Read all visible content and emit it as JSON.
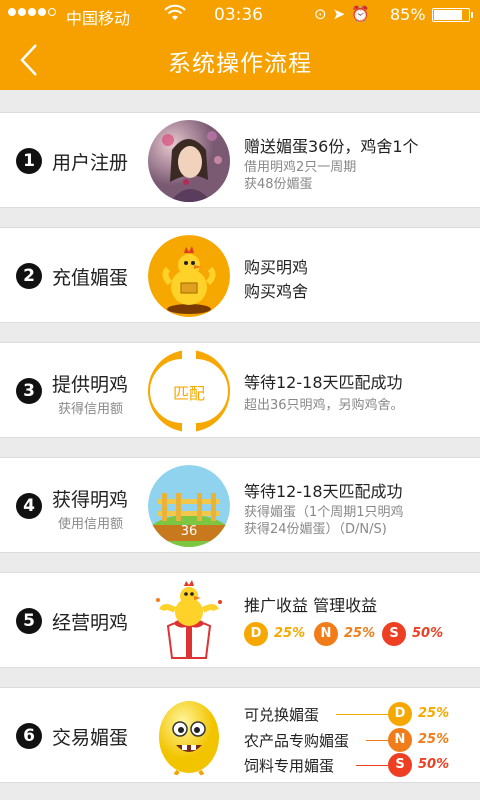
{
  "status_bar": {
    "carrier": "中国移动",
    "time": "03:36",
    "battery_text": "85%",
    "battery_level": 0.85
  },
  "header": {
    "title": "系统操作流程"
  },
  "steps": [
    {
      "number": "1",
      "label": "用户注册",
      "title": "赠送媚蛋36份，鸡舍1个",
      "sub1": "借用明鸡2只一周期",
      "sub2": "获48份媚蛋"
    },
    {
      "number": "2",
      "label": "充值媚蛋",
      "title": "购买明鸡",
      "title2": "购买鸡舍"
    },
    {
      "number": "3",
      "label": "提供明鸡",
      "sublabel": "获得信用额",
      "image_text": "匹配",
      "title": "等待12-18天匹配成功",
      "sub1": "超出36只明鸡，另购鸡舍。"
    },
    {
      "number": "4",
      "label": "获得明鸡",
      "sublabel": "使用信用额",
      "image_text": "36",
      "title": "等待12-18天匹配成功",
      "sub1": "获得媚蛋（1个周期1只明鸡",
      "sub2": "获得24份媚蛋）（D/N/S)"
    },
    {
      "number": "5",
      "label": "经营明鸡",
      "title": "推广收益  管理收益",
      "badges": [
        {
          "letter": "D",
          "pct": "25%"
        },
        {
          "letter": "N",
          "pct": "25%"
        },
        {
          "letter": "S",
          "pct": "50%"
        }
      ]
    },
    {
      "number": "6",
      "label": "交易媚蛋",
      "items": [
        {
          "text": "可兑换媚蛋",
          "letter": "D",
          "pct": "25%"
        },
        {
          "text": "农产品专购媚蛋",
          "letter": "N",
          "pct": "25%"
        },
        {
          "text": "饲料专用媚蛋",
          "letter": "S",
          "pct": "50%"
        }
      ]
    }
  ],
  "colors": {
    "brand": "#f7a100",
    "D": "#f7a800",
    "N": "#f07d1a",
    "S": "#ee3f22"
  }
}
